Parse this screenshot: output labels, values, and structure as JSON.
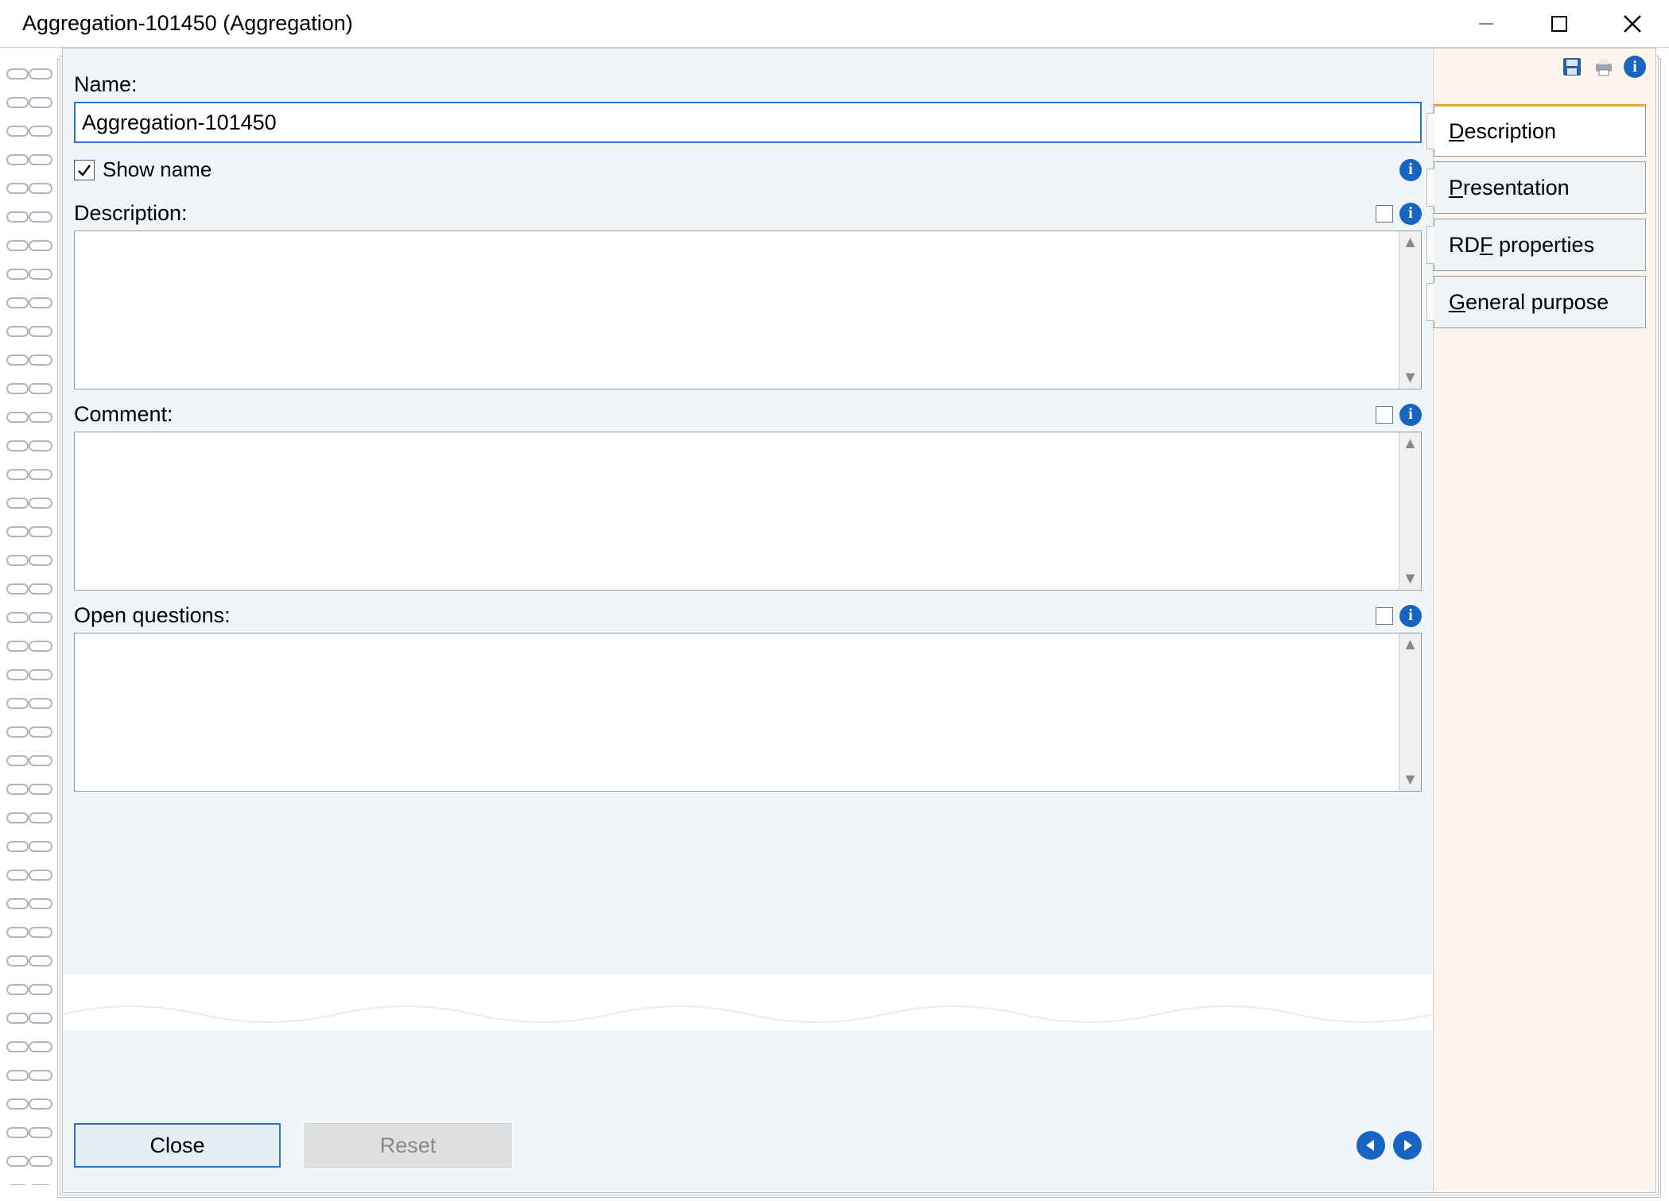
{
  "window": {
    "title": "Aggregation-101450 (Aggregation)"
  },
  "form": {
    "name_label": "Name:",
    "name_value": "Aggregation-101450",
    "show_name_label": "Show name",
    "show_name_checked": true,
    "description_label": "Description:",
    "description_value": "",
    "comment_label": "Comment:",
    "comment_value": "",
    "open_questions_label": "Open questions:",
    "open_questions_value": ""
  },
  "footer": {
    "close_label": "Close",
    "reset_label": "Reset"
  },
  "side": {
    "tabs": [
      {
        "label_pre": "",
        "hot": "D",
        "label_post": "escription",
        "active": true
      },
      {
        "label_pre": "",
        "hot": "P",
        "label_post": "resentation",
        "active": false
      },
      {
        "label_pre": "RD",
        "hot": "F",
        "label_post": " properties",
        "active": false
      },
      {
        "label_pre": "",
        "hot": "G",
        "label_post": "eneral purpose",
        "active": false
      }
    ]
  },
  "icons": {
    "save": "save-icon",
    "print": "print-icon",
    "info": "info-icon",
    "prev": "prev-icon",
    "next": "next-icon"
  }
}
